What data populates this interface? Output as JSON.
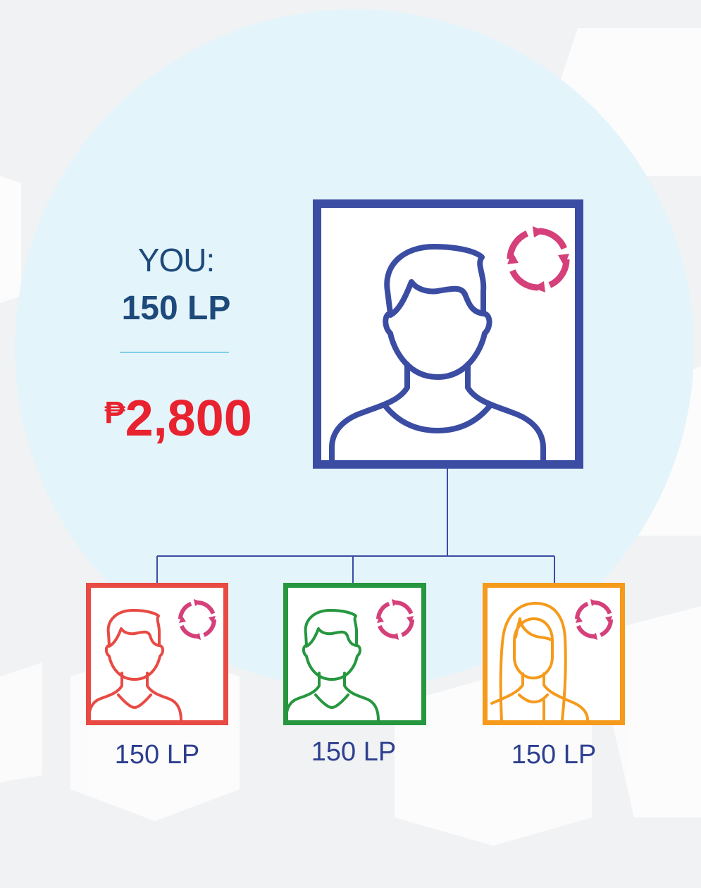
{
  "you": {
    "label": "YOU:",
    "points": "150 LP"
  },
  "earnings": {
    "currency": "₱",
    "amount": "2,800"
  },
  "downlines": [
    {
      "points": "150 LP",
      "color": "#e84a44",
      "avatar": "male-avatar-icon"
    },
    {
      "points": "150 LP",
      "color": "#26973f",
      "avatar": "male-avatar-icon"
    },
    {
      "points": "150 LP",
      "color": "#f59a1b",
      "avatar": "female-avatar-icon"
    }
  ],
  "colors": {
    "main": "#3b4da2",
    "renew_icon": "#d5407a",
    "accent_red": "#e8232f",
    "circle_bg": "#e4f4fb",
    "text_navy": "#1d4a7a"
  }
}
